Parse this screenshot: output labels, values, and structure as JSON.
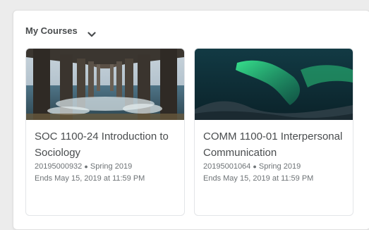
{
  "widget": {
    "title": "My Courses",
    "chevron_icon": "chevron-down-icon"
  },
  "courses": [
    {
      "title": "SOC 1100-24 Introduction to Sociology",
      "code": "20195000932",
      "term": "Spring 2019",
      "ends": "Ends May 15, 2019 at 11:59 PM",
      "image": "pier-underside-ocean-image"
    },
    {
      "title": "COMM 1100-01 Interpersonal Communication",
      "code": "20195001064",
      "term": "Spring 2019",
      "ends": "Ends May 15, 2019 at 11:59 PM",
      "image": "aurora-borealis-image"
    }
  ]
}
